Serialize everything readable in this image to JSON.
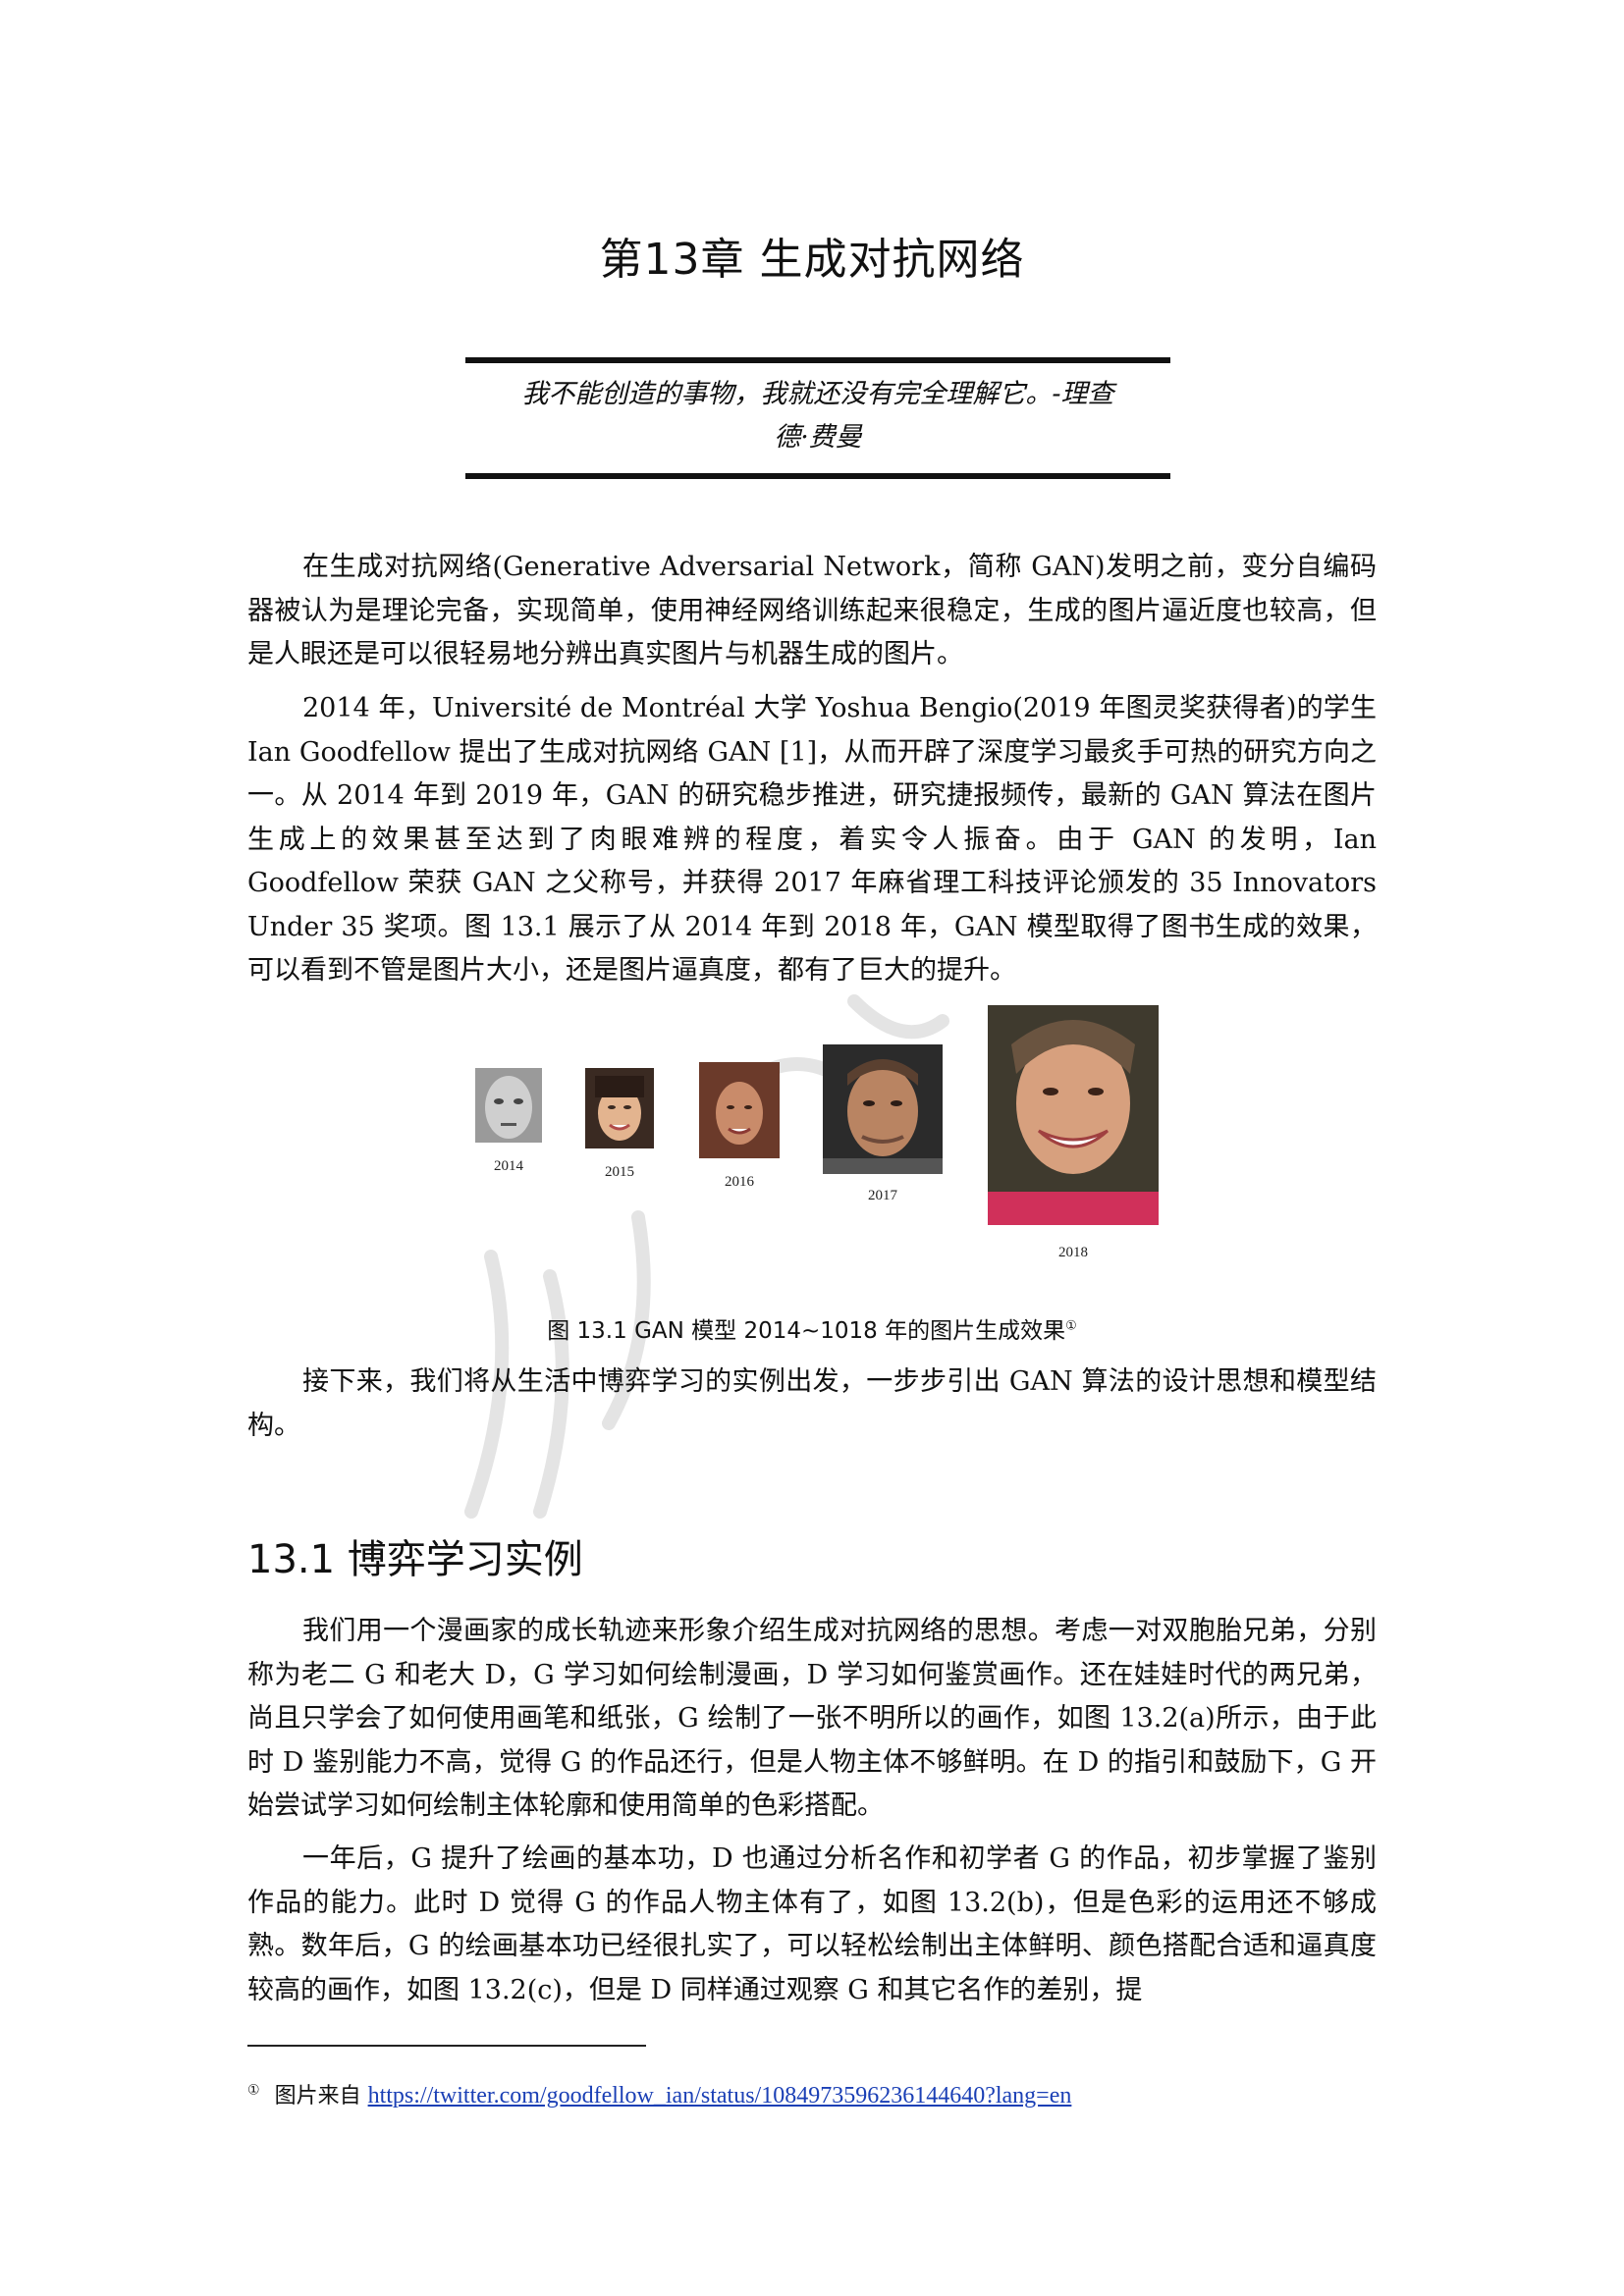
{
  "chapter": {
    "title": "第13章 生成对抗网络"
  },
  "epigraph": {
    "line1": "我不能创造的事物，我就还没有完全理解它。-理查",
    "line2": "德·费曼"
  },
  "paragraphs": {
    "p1": "在生成对抗网络(Generative Adversarial Network，简称 GAN)发明之前，变分自编码器被认为是理论完备，实现简单，使用神经网络训练起来很稳定，生成的图片逼近度也较高，但是人眼还是可以很轻易地分辨出真实图片与机器生成的图片。",
    "p2": "2014 年，Université de Montréal 大学 Yoshua Bengio(2019 年图灵奖获得者)的学生 Ian Goodfellow 提出了生成对抗网络 GAN [1]，从而开辟了深度学习最炙手可热的研究方向之一。从 2014 年到 2019 年，GAN 的研究稳步推进，研究捷报频传，最新的 GAN 算法在图片生成上的效果甚至达到了肉眼难辨的程度，着实令人振奋。由于 GAN 的发明，Ian Goodfellow 荣获 GAN 之父称号，并获得 2017 年麻省理工科技评论颁发的 35 Innovators Under 35 奖项。图 13.1 展示了从 2014 年到 2018 年，GAN 模型取得了图书生成的效果，可以看到不管是图片大小，还是图片逼真度，都有了巨大的提升。",
    "p3": "接下来，我们将从生活中博弈学习的实例出发，一步步引出 GAN 算法的设计思想和模型结构。",
    "p4": "我们用一个漫画家的成长轨迹来形象介绍生成对抗网络的思想。考虑一对双胞胎兄弟，分别称为老二 G 和老大 D，G 学习如何绘制漫画，D 学习如何鉴赏画作。还在娃娃时代的两兄弟，尚且只学会了如何使用画笔和纸张，G 绘制了一张不明所以的画作，如图 13.2(a)所示，由于此时 D 鉴别能力不高，觉得 G 的作品还行，但是人物主体不够鲜明。在 D 的指引和鼓励下，G 开始尝试学习如何绘制主体轮廓和使用简单的色彩搭配。",
    "p5": "一年后，G 提升了绘画的基本功，D 也通过分析名作和初学者 G 的作品，初步掌握了鉴别作品的能力。此时 D 觉得 G 的作品人物主体有了，如图 13.2(b)，但是色彩的运用还不够成熟。数年后，G 的绘画基本功已经很扎实了，可以轻松绘制出主体鲜明、颜色搭配合适和逼真度较高的画作，如图 13.2(c)，但是 D 同样通过观察 G 和其它名作的差别，提"
  },
  "figure": {
    "years": [
      "2014",
      "2015",
      "2016",
      "2017",
      "2018"
    ],
    "caption": "图 13.1 GAN 模型 2014~1018 年的图片生成效果",
    "caption_mark": "①"
  },
  "section": {
    "heading": "13.1 博弈学习实例"
  },
  "footnote": {
    "mark": "①",
    "prefix": "图片来自",
    "link": "https://twitter.com/goodfellow_ian/status/1084973596236144640?lang=en"
  },
  "colors": {
    "link": "#1a3fb5",
    "text": "#111111"
  }
}
